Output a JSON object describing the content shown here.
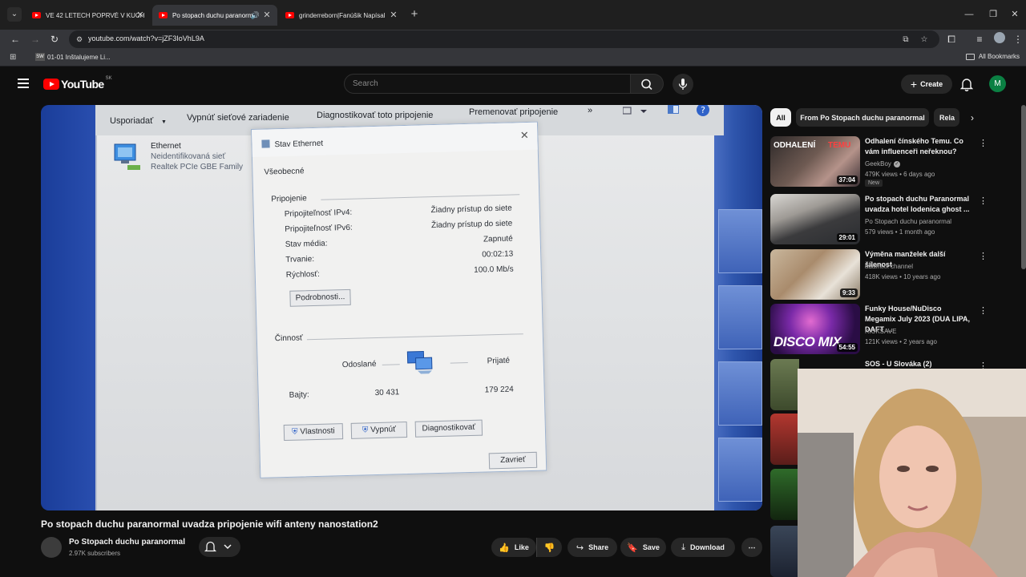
{
  "browser": {
    "tabs": [
      {
        "title": "VE 42 LETECH POPRVÉ V KUCH"
      },
      {
        "title": "Po stopach duchu paranorm"
      },
      {
        "title": "grinderreborn|Fanúšik Napísal"
      }
    ],
    "url": "youtube.com/watch?v=jZF3IoVhL9A",
    "bookmark": "01-01 Inštalujeme Li...",
    "bookmark_favicon": "SW",
    "all_bookmarks": "All Bookmarks"
  },
  "yt_header": {
    "logo_text": "YouTube",
    "country": "SK",
    "search_placeholder": "Search",
    "create_label": "Create",
    "avatar_letter": "M"
  },
  "video_content": {
    "cmdbar": [
      "Usporiadať",
      "Vypnúť sieťové zariadenie",
      "Diagnostikovať toto pripojenie",
      "Premenovať pripojenie",
      "»"
    ],
    "adapter": {
      "name": "Ethernet",
      "status": "Neidentifikovaná sieť",
      "device": "Realtek PCIe GBE Family"
    },
    "dialog": {
      "title": "Stav Ethernet",
      "tab": "Všeobecné",
      "group_connection": "Pripojenie",
      "rows": [
        {
          "label": "Pripojiteľnosť IPv4:",
          "value": "Žiadny prístup do siete"
        },
        {
          "label": "Pripojiteľnosť IPv6:",
          "value": "Žiadny prístup do siete"
        },
        {
          "label": "Stav média:",
          "value": "Zapnuté"
        },
        {
          "label": "Trvanie:",
          "value": "00:02:13"
        },
        {
          "label": "Rýchlosť:",
          "value": "100.0 Mb/s"
        }
      ],
      "details_button": "Podrobnosti...",
      "group_activity": "Činnosť",
      "sent_label": "Odoslané",
      "received_label": "Prijaté",
      "bytes_label": "Bajty:",
      "bytes_sent": "30 431",
      "bytes_received": "179 224",
      "buttons": [
        "Vlastnosti",
        "Vypnúť",
        "Diagnostikovať"
      ],
      "close_button": "Zavrieť"
    }
  },
  "video_info": {
    "title": "Po stopach duchu paranormal uvadza pripojenie wifi anteny nanostation2",
    "channel": "Po Stopach duchu paranormal",
    "subscribers": "2.97K subscribers",
    "actions": {
      "like": "Like",
      "share": "Share",
      "save": "Save",
      "download": "Download"
    }
  },
  "sidebar": {
    "chips": [
      "All",
      "From Po Stopach duchu paranormal",
      "Rela"
    ],
    "recommendations": [
      {
        "title": "Odhalení čínského Temu. Co vám influenceři neřeknou?",
        "channel": "GeekBoy",
        "meta": "479K views • 6 days ago",
        "duration": "37:04",
        "badge": "New",
        "verified": true
      },
      {
        "title": "Po stopach duchu Paranormal uvadza hotel lodenica ghost ...",
        "channel": "Po Stopach duchu paranormal",
        "meta": "579 views • 1 month ago",
        "duration": "29:01"
      },
      {
        "title": "Výměna manželek další šílenost",
        "channel": "adamixx channel",
        "meta": "418K views • 10 years ago",
        "duration": "9:33"
      },
      {
        "title": "Funky House/NuDisco Megamix July 2023 (DUA LIPA, DAFT ...",
        "channel": "KICKSAVE",
        "meta": "121K views • 2 years ago",
        "duration": "54:55",
        "thumb_text": "DISCO MIX"
      },
      {
        "title": "SOS - U Slováka (2)"
      }
    ]
  }
}
